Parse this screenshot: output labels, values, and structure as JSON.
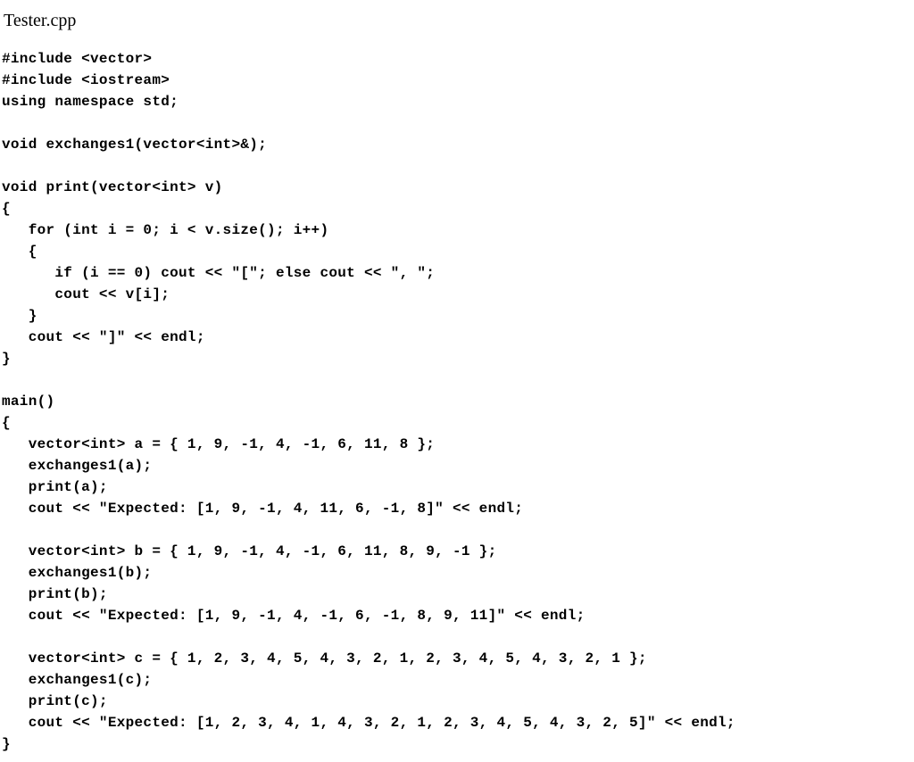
{
  "title": "Tester.cpp",
  "code": "#include <vector>\n#include <iostream>\nusing namespace std;\n\nvoid exchanges1(vector<int>&);\n\nvoid print(vector<int> v)\n{\n   for (int i = 0; i < v.size(); i++)\n   {\n      if (i == 0) cout << \"[\"; else cout << \", \";\n      cout << v[i];\n   }\n   cout << \"]\" << endl;\n}\n\nmain()\n{\n   vector<int> a = { 1, 9, -1, 4, -1, 6, 11, 8 };\n   exchanges1(a);\n   print(a);\n   cout << \"Expected: [1, 9, -1, 4, 11, 6, -1, 8]\" << endl;\n\n   vector<int> b = { 1, 9, -1, 4, -1, 6, 11, 8, 9, -1 };\n   exchanges1(b);\n   print(b);\n   cout << \"Expected: [1, 9, -1, 4, -1, 6, -1, 8, 9, 11]\" << endl;\n\n   vector<int> c = { 1, 2, 3, 4, 5, 4, 3, 2, 1, 2, 3, 4, 5, 4, 3, 2, 1 };\n   exchanges1(c);\n   print(c);\n   cout << \"Expected: [1, 2, 3, 4, 1, 4, 3, 2, 1, 2, 3, 4, 5, 4, 3, 2, 5]\" << endl;\n}"
}
